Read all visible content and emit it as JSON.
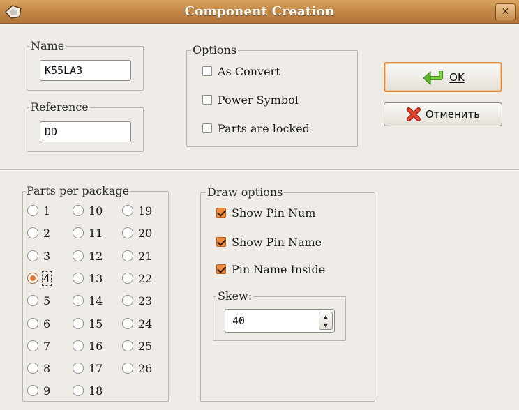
{
  "window": {
    "title": "Component Creation",
    "close_label": "✕"
  },
  "name_group": {
    "label": "Name",
    "value": "K55LA3"
  },
  "reference_group": {
    "label": "Reference",
    "value": "DD"
  },
  "options_group": {
    "label": "Options",
    "items": [
      {
        "label": "As Convert",
        "checked": false
      },
      {
        "label": "Power Symbol",
        "checked": false
      },
      {
        "label": "Parts are locked",
        "checked": false
      }
    ]
  },
  "buttons": {
    "ok_label": "OK",
    "cancel_label": "Отменить"
  },
  "parts_group": {
    "label": "Parts per package",
    "selected": "4",
    "options": [
      "1",
      "2",
      "3",
      "4",
      "5",
      "6",
      "7",
      "8",
      "9",
      "10",
      "11",
      "12",
      "13",
      "14",
      "15",
      "16",
      "17",
      "18",
      "19",
      "20",
      "21",
      "22",
      "23",
      "24",
      "25",
      "26"
    ]
  },
  "draw_group": {
    "label": "Draw options",
    "items": [
      {
        "label": "Show Pin Num",
        "checked": true
      },
      {
        "label": "Show Pin Name",
        "checked": true
      },
      {
        "label": "Pin Name Inside",
        "checked": true
      }
    ]
  },
  "skew_group": {
    "label": "Skew:",
    "value": "40"
  },
  "colors": {
    "titlebar": "#c58a48",
    "accent": "#e8742a",
    "background": "#efebe7"
  }
}
